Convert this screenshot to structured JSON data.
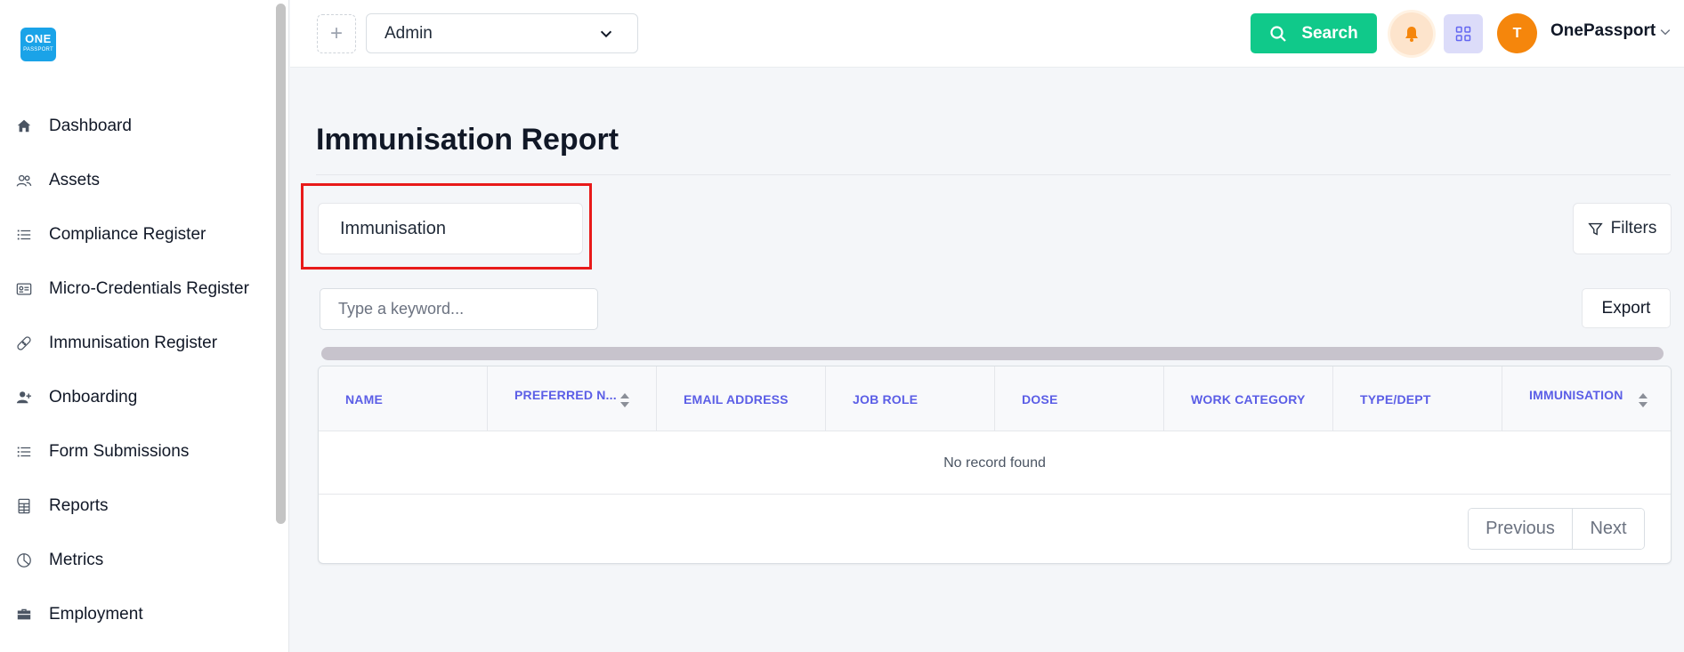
{
  "logo": {
    "line1": "ONE",
    "line2": "PASSPORT"
  },
  "sidebar": {
    "items": [
      {
        "label": "Dashboard",
        "icon": "home-icon"
      },
      {
        "label": "Assets",
        "icon": "users-icon"
      },
      {
        "label": "Compliance Register",
        "icon": "list-icon"
      },
      {
        "label": "Micro-Credentials Register",
        "icon": "id-card-icon"
      },
      {
        "label": "Immunisation Register",
        "icon": "bandage-icon"
      },
      {
        "label": "Onboarding",
        "icon": "user-plus-icon"
      },
      {
        "label": "Form Submissions",
        "icon": "list-icon"
      },
      {
        "label": "Reports",
        "icon": "spreadsheet-icon"
      },
      {
        "label": "Metrics",
        "icon": "pie-chart-icon"
      },
      {
        "label": "Employment",
        "icon": "briefcase-icon"
      }
    ]
  },
  "header": {
    "role_value": "Admin",
    "search_label": "Search",
    "avatar_initial": "T",
    "user_name": "OnePassport",
    "accent_green": "#10c98a",
    "avatar_color": "#f5860c"
  },
  "main": {
    "title": "Immunisation Report",
    "tab_label": "Immunisation",
    "filters_label": "Filters",
    "keyword_placeholder": "Type a keyword...",
    "export_label": "Export",
    "columns": [
      {
        "label": "NAME",
        "sortable": false
      },
      {
        "label": "PREFERRED N...",
        "sortable": true
      },
      {
        "label": "EMAIL ADDRESS",
        "sortable": false
      },
      {
        "label": "JOB ROLE",
        "sortable": false
      },
      {
        "label": "DOSE",
        "sortable": false
      },
      {
        "label": "WORK CATEGORY",
        "sortable": false
      },
      {
        "label": "TYPE/DEPT",
        "sortable": false
      },
      {
        "label": "IMMUNISATION",
        "sortable": true
      }
    ],
    "empty_message": "No record found",
    "prev_label": "Previous",
    "next_label": "Next",
    "highlight_color": "#e81a1a"
  }
}
